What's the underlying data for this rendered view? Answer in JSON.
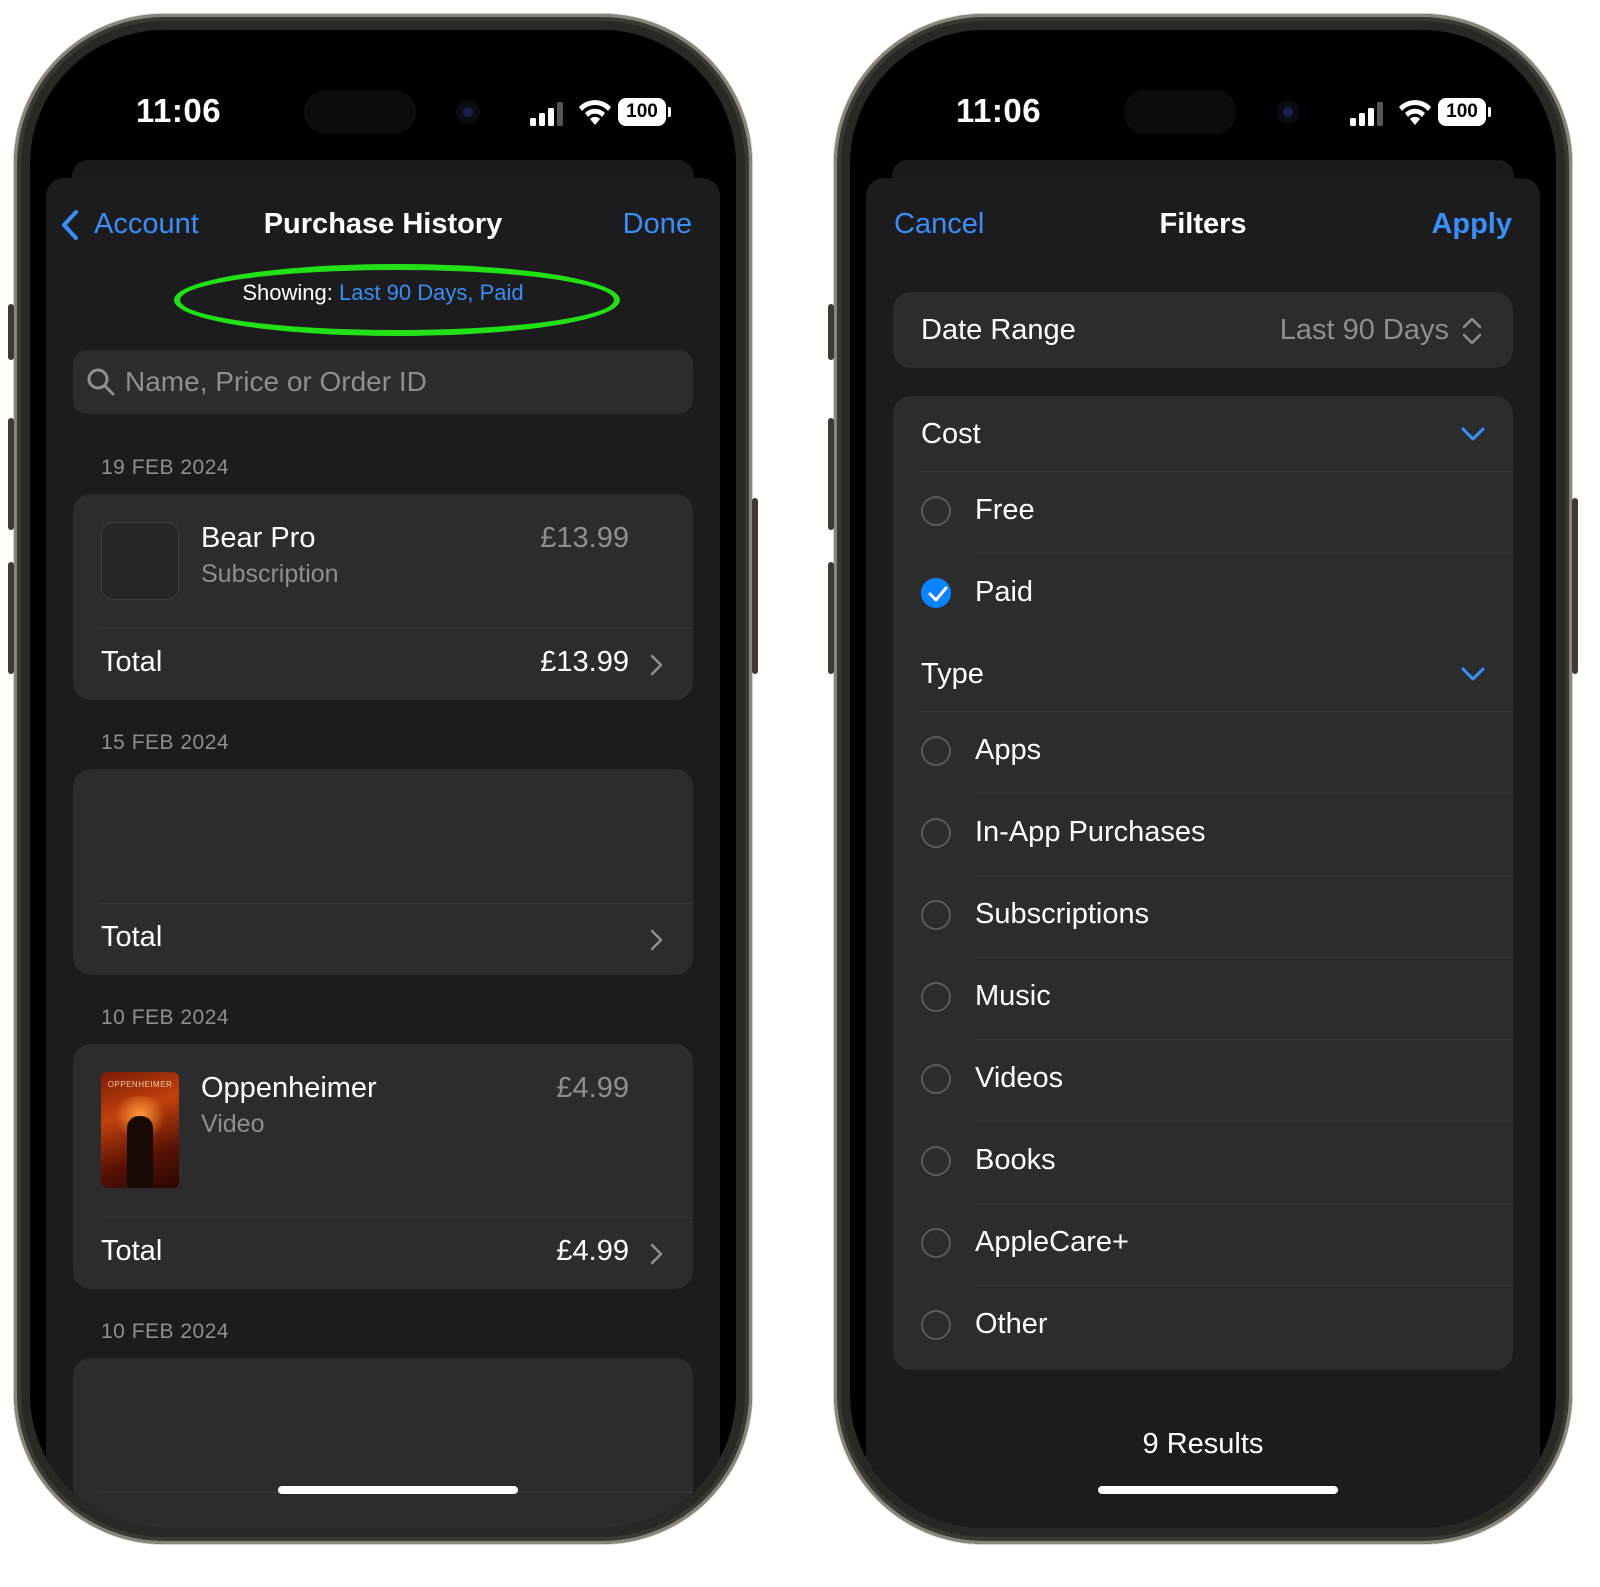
{
  "left_phone": {
    "status": {
      "time": "11:06",
      "battery": "100"
    },
    "nav": {
      "back_label": "Account",
      "title": "Purchase History",
      "done_label": "Done"
    },
    "showing": {
      "prefix": "Showing: ",
      "filter": "Last 90 Days, Paid"
    },
    "search": {
      "placeholder": "Name, Price or Order ID"
    },
    "sections": [
      {
        "date": "19 FEB 2024",
        "item_name": "Bear Pro",
        "item_type": "Subscription",
        "item_price": "£13.99",
        "total_label": "Total",
        "total_price": "£13.99"
      },
      {
        "date": "15 FEB 2024",
        "total_label": "Total",
        "total_price": ""
      },
      {
        "date": "10 FEB 2024",
        "item_name": "Oppenheimer",
        "item_type": "Video",
        "item_price": "£4.99",
        "total_label": "Total",
        "total_price": "£4.99",
        "poster_text": "OPPENHEIMER"
      },
      {
        "date": "10 FEB 2024"
      }
    ]
  },
  "right_phone": {
    "status": {
      "time": "11:06",
      "battery": "100"
    },
    "nav": {
      "cancel_label": "Cancel",
      "title": "Filters",
      "apply_label": "Apply"
    },
    "date_range": {
      "label": "Date Range",
      "value": "Last 90 Days"
    },
    "cost": {
      "label": "Cost",
      "options": [
        {
          "label": "Free",
          "selected": false
        },
        {
          "label": "Paid",
          "selected": true
        }
      ]
    },
    "type": {
      "label": "Type",
      "options": [
        {
          "label": "Apps",
          "selected": false
        },
        {
          "label": "In-App Purchases",
          "selected": false
        },
        {
          "label": "Subscriptions",
          "selected": false
        },
        {
          "label": "Music",
          "selected": false
        },
        {
          "label": "Videos",
          "selected": false
        },
        {
          "label": "Books",
          "selected": false
        },
        {
          "label": "AppleCare+",
          "selected": false
        },
        {
          "label": "Other",
          "selected": false
        }
      ]
    },
    "results": "9 Results"
  },
  "colors": {
    "accent": "#3b8ef6",
    "highlight_oval": "#22e016",
    "background": "#1c1c1e",
    "card": "#2c2c2e"
  }
}
